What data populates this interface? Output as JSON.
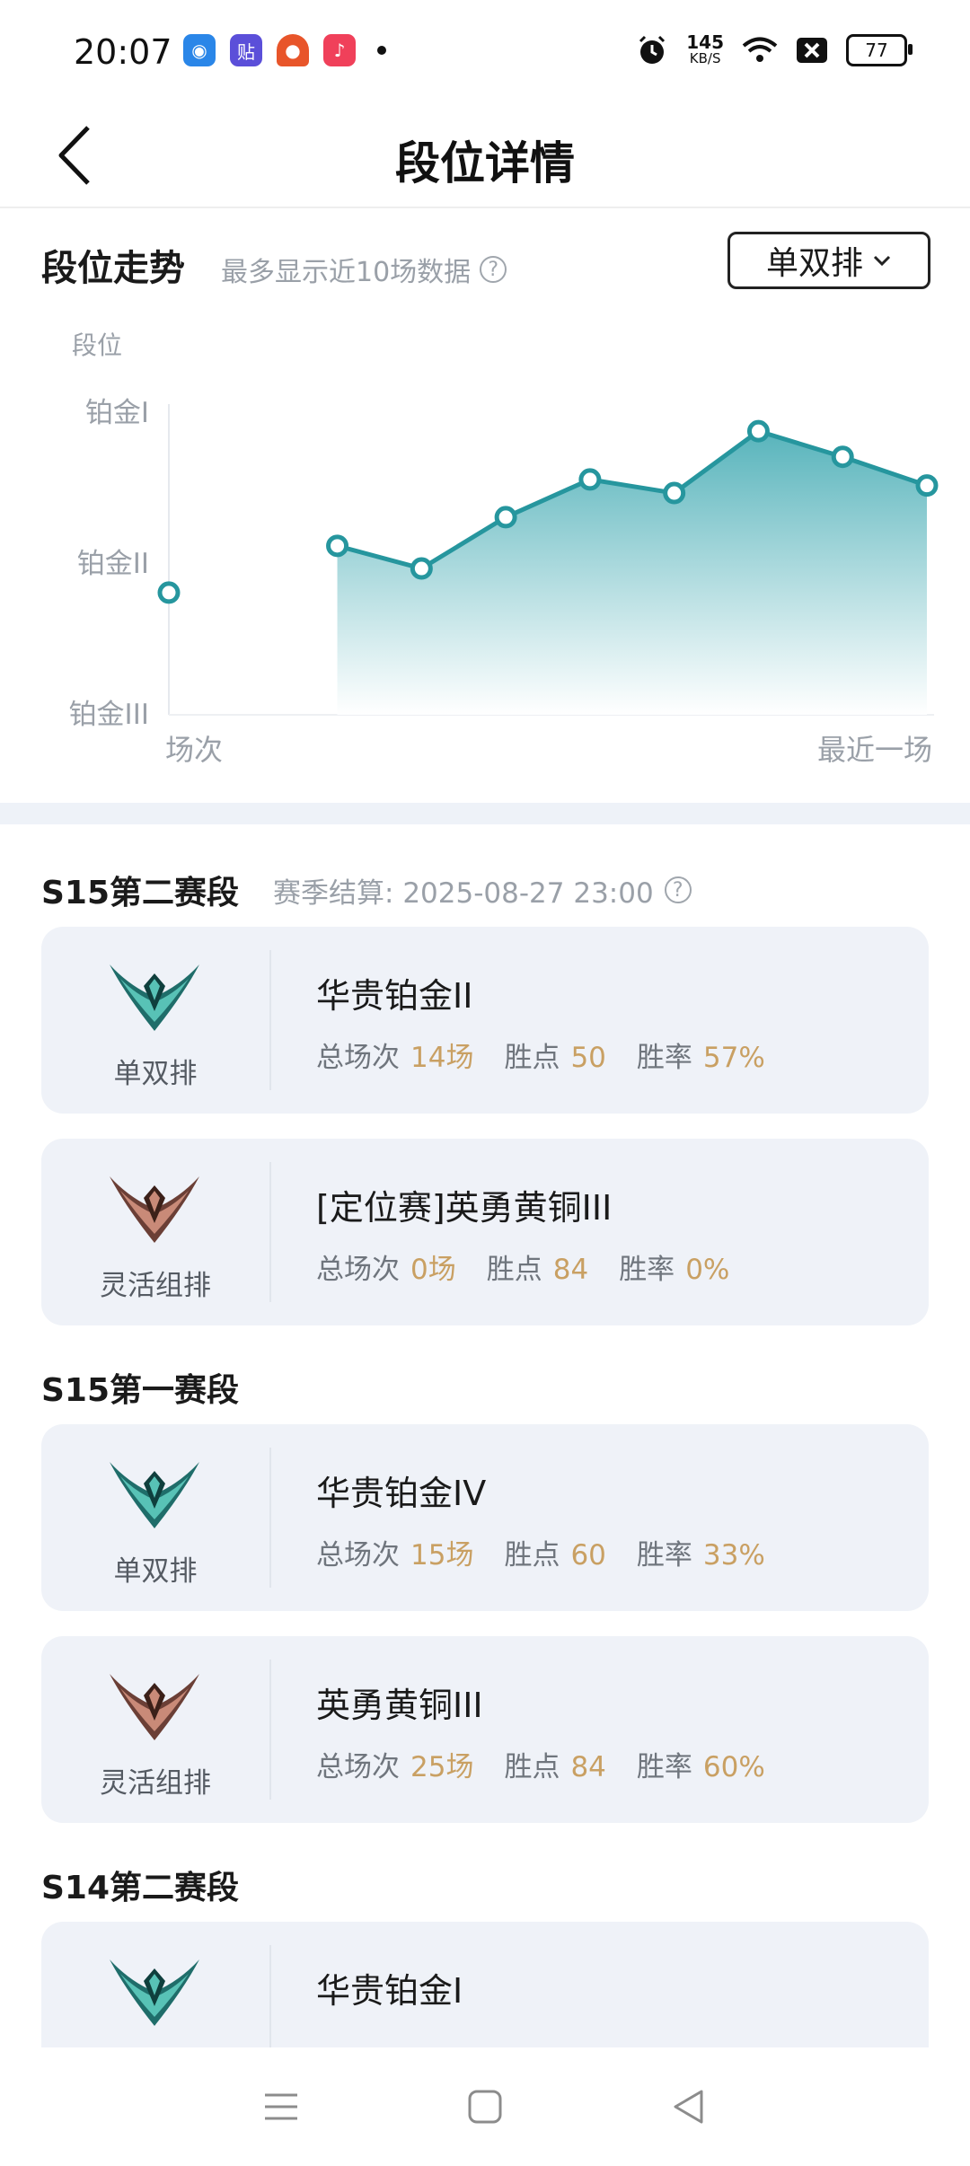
{
  "status_bar": {
    "time": "20:07",
    "net_speed": "145",
    "net_unit": "KB/S",
    "battery": "77"
  },
  "header": {
    "title": "段位详情"
  },
  "trend": {
    "title": "段位走势",
    "hint": "最多显示近10场数据",
    "queue_selector": "单双排"
  },
  "chart_data": {
    "type": "line",
    "ylabel": "段位",
    "y_ticks": [
      "铂金I",
      "铂金II",
      "铂金III"
    ],
    "x_start_label": "场次",
    "x_end_label": "最近一场",
    "x": [
      1,
      2,
      3,
      4,
      5,
      6,
      7,
      8,
      9,
      10
    ],
    "values": [
      0.81,
      null,
      1.12,
      0.97,
      1.31,
      1.56,
      1.47,
      1.88,
      1.71,
      1.52
    ],
    "ylim": [
      0,
      2
    ],
    "area_fill": true,
    "colors": {
      "line": "#26969e",
      "fill": "#6dc0c6"
    }
  },
  "seasons": [
    {
      "title": "S15第二赛段",
      "settle": "赛季结算: 2025-08-27 23:00",
      "cards": [
        {
          "queue": "单双排",
          "emblem": "platinum-emblem-icon",
          "rank": "华贵铂金II",
          "games_label": "总场次",
          "games": "14场",
          "lp_label": "胜点",
          "lp": "50",
          "wr_label": "胜率",
          "wr": "57%"
        },
        {
          "queue": "灵活组排",
          "emblem": "bronze-emblem-icon",
          "rank": "[定位赛]英勇黄铜III",
          "games_label": "总场次",
          "games": "0场",
          "lp_label": "胜点",
          "lp": "84",
          "wr_label": "胜率",
          "wr": "0%"
        }
      ]
    },
    {
      "title": "S15第一赛段",
      "cards": [
        {
          "queue": "单双排",
          "emblem": "platinum-emblem-icon",
          "rank": "华贵铂金IV",
          "games_label": "总场次",
          "games": "15场",
          "lp_label": "胜点",
          "lp": "60",
          "wr_label": "胜率",
          "wr": "33%"
        },
        {
          "queue": "灵活组排",
          "emblem": "bronze-emblem-icon",
          "rank": "英勇黄铜III",
          "games_label": "总场次",
          "games": "25场",
          "lp_label": "胜点",
          "lp": "84",
          "wr_label": "胜率",
          "wr": "60%"
        }
      ]
    },
    {
      "title": "S14第二赛段",
      "cards": [
        {
          "queue": "",
          "emblem": "platinum-emblem-icon",
          "rank": "华贵铂金I"
        }
      ]
    }
  ],
  "colors": {
    "accent": "#26969e",
    "value_gold": "#c9a063",
    "card_bg": "#eff2f8"
  }
}
